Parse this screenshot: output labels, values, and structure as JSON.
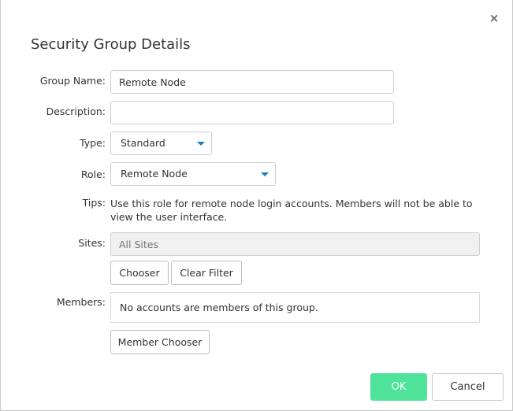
{
  "dialog": {
    "close_icon": "×",
    "title": "Security Group Details"
  },
  "form": {
    "group_name_label": "Group Name:",
    "group_name_value": "Remote Node",
    "description_label": "Description:",
    "description_value": "",
    "type_label": "Type:",
    "type_value": "Standard",
    "role_label": "Role:",
    "role_value": "Remote Node",
    "tips_label": "Tips:",
    "tips_text": "Use this role for remote node login accounts. Members will not be able to view the user interface.",
    "sites_label": "Sites:",
    "sites_placeholder": "All Sites",
    "chooser_label": "Chooser",
    "clear_filter_label": "Clear Filter",
    "members_label": "Members:",
    "members_text": "No accounts are members of this group.",
    "member_chooser_label": "Member Chooser"
  },
  "footer": {
    "ok_label": "OK",
    "cancel_label": "Cancel"
  },
  "colors": {
    "ok_button": "#50e39a",
    "caret": "#1a7fb4"
  }
}
